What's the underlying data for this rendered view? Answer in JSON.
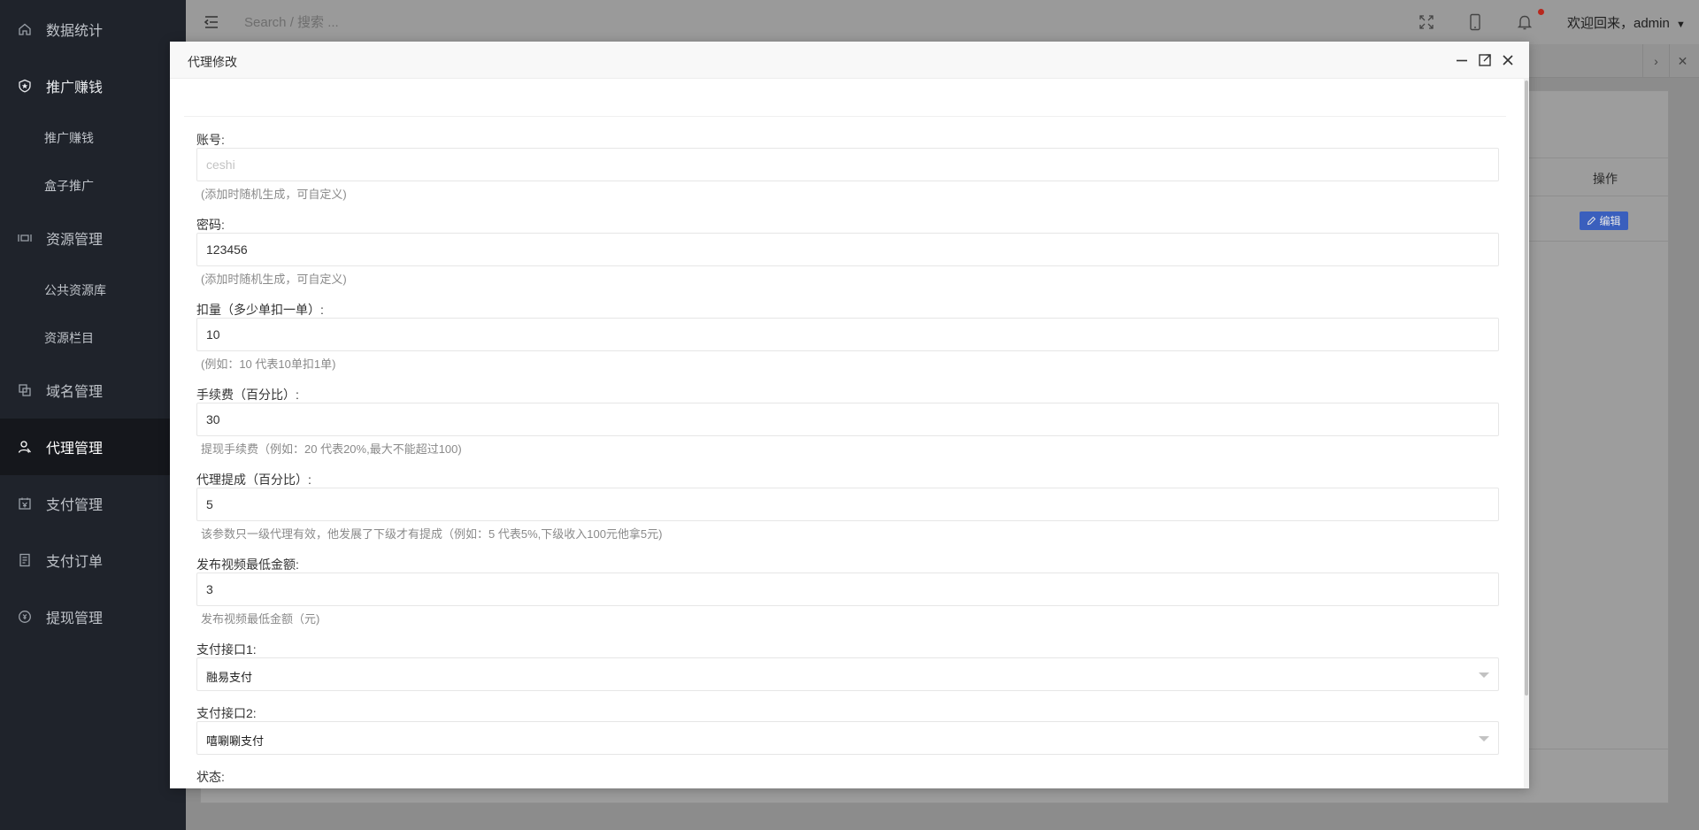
{
  "sidebar": {
    "items": [
      {
        "label": "数据统计",
        "icon": "home-icon"
      },
      {
        "label": "推广赚钱",
        "icon": "shield-icon"
      },
      {
        "label": "推广赚钱"
      },
      {
        "label": "盒子推广"
      },
      {
        "label": "资源管理",
        "icon": "resource-icon"
      },
      {
        "label": "公共资源库"
      },
      {
        "label": "资源栏目"
      },
      {
        "label": "域名管理",
        "icon": "domain-icon"
      },
      {
        "label": "代理管理",
        "icon": "agent-icon"
      },
      {
        "label": "支付管理",
        "icon": "payment-icon"
      },
      {
        "label": "支付订单",
        "icon": "order-icon"
      },
      {
        "label": "提现管理",
        "icon": "withdraw-icon"
      }
    ]
  },
  "header": {
    "search_placeholder": "Search / 搜索 ...",
    "user_greeting": "欢迎回来，admin"
  },
  "background": {
    "table_header_action": "操作",
    "edit_button": "编辑"
  },
  "modal": {
    "title": "代理修改",
    "fields": [
      {
        "label": "账号:",
        "value": "",
        "placeholder": "ceshi",
        "help": "(添加时随机生成，可自定义)"
      },
      {
        "label": "密码:",
        "value": "123456",
        "help": "(添加时随机生成，可自定义)"
      },
      {
        "label": "扣量（多少单扣一单）:",
        "value": "10",
        "help": "(例如：10 代表10单扣1单)"
      },
      {
        "label": "手续费（百分比）:",
        "value": "30",
        "help": "提现手续费（例如：20 代表20%,最大不能超过100)"
      },
      {
        "label": "代理提成（百分比）:",
        "value": "5",
        "help": "该参数只一级代理有效，他发展了下级才有提成（例如：5 代表5%,下级收入100元他拿5元)"
      },
      {
        "label": "发布视频最低金额:",
        "value": "3",
        "help": "发布视频最低金额（元)"
      }
    ],
    "selects": [
      {
        "label": "支付接口1:",
        "value": "融易支付"
      },
      {
        "label": "支付接口2:",
        "value": "嘻唰唰支付"
      }
    ],
    "status_label": "状态:"
  },
  "colors": {
    "sidebar_bg": "#1f232b",
    "edit_button": "#3a5fbd",
    "notification_dot": "#b8281d"
  }
}
